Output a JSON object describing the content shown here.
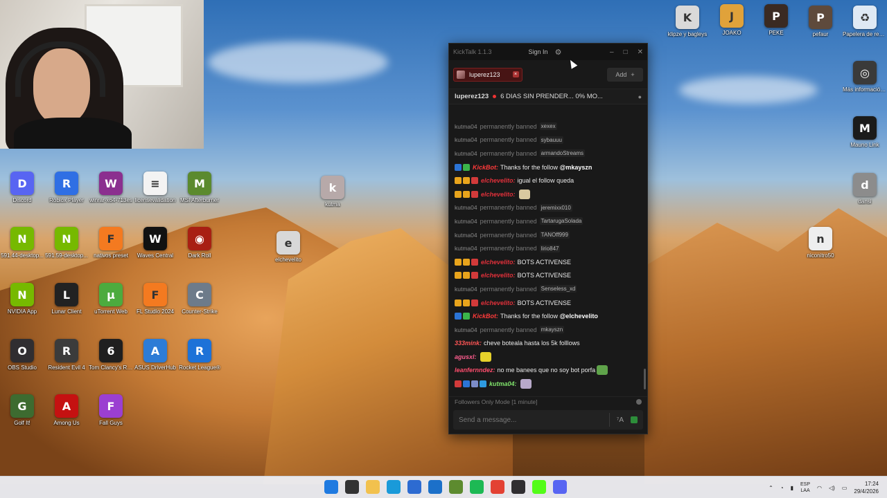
{
  "desktop": {
    "icons_left": [
      {
        "label": "Discord",
        "color": "#5865f2",
        "glyph": "D"
      },
      {
        "label": "Roblox Player",
        "color": "#2f6fe4",
        "glyph": "R"
      },
      {
        "label": "winrar-x64-713es",
        "color": "#8b2f8f",
        "glyph": "W"
      },
      {
        "label": "licensevalidation",
        "color": "#f3f3f3",
        "glyph": "≡"
      },
      {
        "label": "MSI Afterburner",
        "color": "#5b8a2e",
        "glyph": "M"
      },
      {
        "label": "591.44-desktop...",
        "color": "#76b900",
        "glyph": "N"
      },
      {
        "label": "591.59-desktop...",
        "color": "#76b900",
        "glyph": "N"
      },
      {
        "label": "nativos preset",
        "color": "#f47a20",
        "glyph": "F"
      },
      {
        "label": "Waves Central",
        "color": "#111111",
        "glyph": "W"
      },
      {
        "label": "Dark Roll",
        "color": "#a81f13",
        "glyph": "◉"
      },
      {
        "label": "NVIDIA App",
        "color": "#76b900",
        "glyph": "N"
      },
      {
        "label": "Lunar Client",
        "color": "#222222",
        "glyph": "L"
      },
      {
        "label": "uTorrent Web",
        "color": "#4cab3e",
        "glyph": "μ"
      },
      {
        "label": "FL Studio 2024",
        "color": "#f47a20",
        "glyph": "F"
      },
      {
        "label": "Counter-Strike",
        "color": "#6d7b8a",
        "glyph": "C"
      },
      {
        "label": "OBS Studio",
        "color": "#302e31",
        "glyph": "O"
      },
      {
        "label": "Resident Evil 4",
        "color": "#3b3b3b",
        "glyph": "R"
      },
      {
        "label": "Tom Clancy's Rainbow Six...",
        "color": "#1f1f1f",
        "glyph": "6"
      },
      {
        "label": "ASUS DriverHub",
        "color": "#2d7cd6",
        "glyph": "A"
      },
      {
        "label": "Rocket League®",
        "color": "#1d72d8",
        "glyph": "R"
      },
      {
        "label": "Golf It!",
        "color": "#3d6b30",
        "glyph": "G"
      },
      {
        "label": "Among Us",
        "color": "#c51111",
        "glyph": "A"
      },
      {
        "label": "Fall Guys",
        "color": "#9b3fd1",
        "glyph": "F"
      }
    ],
    "icons_right": [
      {
        "label": "klipze y bagleys",
        "color": "#d9d9d9",
        "glyph": "K"
      },
      {
        "label": "JOAKO",
        "color": "#e0a23a",
        "glyph": "J"
      },
      {
        "label": "PEKE",
        "color": "#3a2a22",
        "glyph": "P"
      },
      {
        "label": "pefaur",
        "color": "#5e4a3c",
        "glyph": "P"
      },
      {
        "label": "Papelera de reciclaje",
        "color": "#dfe9f4",
        "glyph": "♻"
      },
      {
        "label": "Más información sobre esta ima...",
        "color": "#3a3a3a",
        "glyph": "◎"
      },
      {
        "label": "Mauno Link",
        "color": "#1b1b1b",
        "glyph": "M"
      },
      {
        "label": "dansi",
        "color": "#8c8c8c",
        "glyph": "d"
      },
      {
        "label": "niconitro50",
        "color": "#eeeeee",
        "glyph": "n"
      }
    ],
    "icons_mid": [
      {
        "label": "kutma",
        "color": "#b7a9a9",
        "glyph": "k"
      },
      {
        "label": "elchevelito",
        "color": "#d8d8d8",
        "glyph": "e"
      }
    ]
  },
  "app": {
    "title": "KickTalk 1.1.3",
    "sign_in": "Sign In",
    "gear_icon": "⚙",
    "tab_label": "luperez123",
    "tab_close": "×",
    "add_label": "Add",
    "add_plus": "+",
    "channel": "luperez123",
    "stream_title": "6 DIAS SIN PRENDER... 0% MO...",
    "mode_text": "Followers Only Mode [1 minute]",
    "input_placeholder": "Send a message...",
    "translate_glyph": "⁷A"
  },
  "chat": {
    "ban_word": "permanently banned",
    "messages": [
      {
        "kind": "ban",
        "who": "kutma04",
        "target": "xexex"
      },
      {
        "kind": "ban",
        "who": "kutma04",
        "target": "sybauuu"
      },
      {
        "kind": "ban",
        "who": "kutma04",
        "target": "armandoStreams"
      },
      {
        "kind": "msg",
        "user": "KickBot:",
        "color": "#ff3a3a",
        "badges": [
          "#2b74d6",
          "#3bb54a"
        ],
        "text": "Thanks for the follow ",
        "bold": "@mkayszn",
        "emote": ""
      },
      {
        "kind": "msg",
        "user": "elchevelito:",
        "color": "#e0303a",
        "badges": [
          "#e8a41c",
          "#e8a41c",
          "#d23a3a"
        ],
        "text": "igual el follow queda",
        "bold": "",
        "emote": ""
      },
      {
        "kind": "msg",
        "user": "elchevelito:",
        "color": "#e0303a",
        "badges": [
          "#e8a41c",
          "#e8a41c",
          "#d23a3a"
        ],
        "text": "",
        "bold": "",
        "emote": "#d9c9a0"
      },
      {
        "kind": "ban",
        "who": "kutma04",
        "target": "jeremixx010"
      },
      {
        "kind": "ban",
        "who": "kutma04",
        "target": "TartarugaSolada"
      },
      {
        "kind": "ban",
        "who": "kutma04",
        "target": "TANOff999"
      },
      {
        "kind": "ban",
        "who": "kutma04",
        "target": "lirio847"
      },
      {
        "kind": "msg",
        "user": "elchevelito:",
        "color": "#e0303a",
        "badges": [
          "#e8a41c",
          "#e8a41c",
          "#d23a3a"
        ],
        "text": "BOTS ACTIVENSE",
        "bold": "",
        "emote": ""
      },
      {
        "kind": "msg",
        "user": "elchevelito:",
        "color": "#e0303a",
        "badges": [
          "#e8a41c",
          "#e8a41c",
          "#d23a3a"
        ],
        "text": "BOTS ACTIVENSE",
        "bold": "",
        "emote": ""
      },
      {
        "kind": "ban",
        "who": "kutma04",
        "target": "Senseless_xd"
      },
      {
        "kind": "msg",
        "user": "elchevelito:",
        "color": "#e0303a",
        "badges": [
          "#e8a41c",
          "#e8a41c",
          "#d23a3a"
        ],
        "text": "BOTS ACTIVENSE",
        "bold": "",
        "emote": ""
      },
      {
        "kind": "msg",
        "user": "KickBot:",
        "color": "#ff3a3a",
        "badges": [
          "#2b74d6",
          "#3bb54a"
        ],
        "text": "Thanks for the follow ",
        "bold": "@elchevelito",
        "emote": ""
      },
      {
        "kind": "ban",
        "who": "kutma04",
        "target": "mkayszn"
      },
      {
        "kind": "msg",
        "user": "333mink:",
        "color": "#ff5555",
        "badges": [],
        "text": "cheve boteala hasta los 5k folllows",
        "bold": "",
        "emote": ""
      },
      {
        "kind": "msg",
        "user": "agusxl:",
        "color": "#ff5d8f",
        "badges": [],
        "text": "",
        "bold": "",
        "emote": "#e6d12b"
      },
      {
        "kind": "msg",
        "user": "leanfernndez:",
        "color": "#ff4d6d",
        "badges": [],
        "text": "no me banees que no soy bot porfa",
        "bold": "",
        "emote": "#5fa34a"
      },
      {
        "kind": "msg",
        "user": "kutma04:",
        "color": "#7fe36b",
        "badges": [
          "#d23a3a",
          "#2b74d6",
          "#7c8cc8",
          "#2e9be0"
        ],
        "text": "",
        "bold": "",
        "emote": "#b7a9c9"
      }
    ]
  },
  "taskbar": {
    "apps": [
      {
        "name": "start-button",
        "color": "#1f7ae0"
      },
      {
        "name": "search-icon",
        "color": "#333333"
      },
      {
        "name": "file-explorer-icon",
        "color": "#f2c14e"
      },
      {
        "name": "edge-icon",
        "color": "#1a9ad9"
      },
      {
        "name": "store-icon",
        "color": "#2d6bd1"
      },
      {
        "name": "outlook-icon",
        "color": "#1c70c9"
      },
      {
        "name": "minecraft-icon",
        "color": "#5d8b2f"
      },
      {
        "name": "spotify-icon",
        "color": "#1db954"
      },
      {
        "name": "chrome-icon",
        "color": "#e34133"
      },
      {
        "name": "obs-icon",
        "color": "#302e31"
      },
      {
        "name": "kick-icon",
        "color": "#53fc18"
      },
      {
        "name": "discord-icon",
        "color": "#5865f2"
      }
    ],
    "lang_top": "ESP",
    "lang_bottom": "LAA",
    "time": "17:24",
    "date": "29/4/2026"
  }
}
